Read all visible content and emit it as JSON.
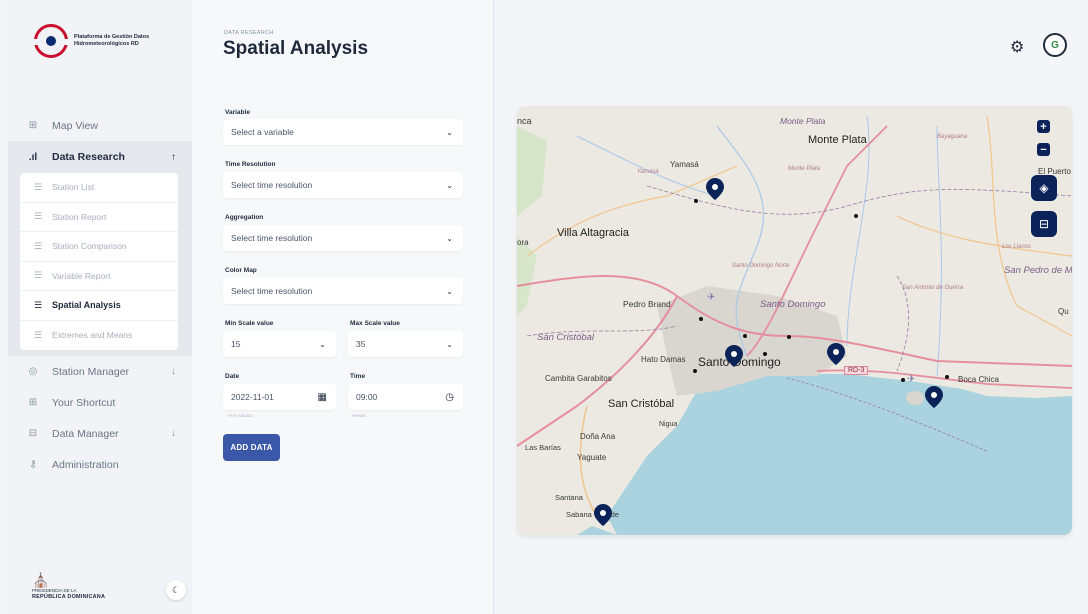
{
  "sidebar": {
    "logo_text": "Plataforma de Gestión Datos Hidrometeorológicos RD",
    "items": [
      {
        "label": "Map View",
        "icon": "map-icon"
      },
      {
        "label": "Data Research",
        "icon": "chart-icon"
      },
      {
        "label": "Station Manager",
        "icon": "location-icon"
      },
      {
        "label": "Your Shortcut",
        "icon": "grid-icon"
      },
      {
        "label": "Data Manager",
        "icon": "database-icon"
      },
      {
        "label": "Administration",
        "icon": "key-icon"
      }
    ],
    "submenu": [
      "Station List",
      "Station Report",
      "Station Comparison",
      "Variable Report",
      "Spatial Analysis",
      "Extremes and Means"
    ],
    "footer_line1": "PRESIDENCIA DE LA",
    "footer_line2": "REPÚBLICA DOMINICANA"
  },
  "header": {
    "eyebrow": "DATA RESEARCH",
    "title": "Spatial Analysis"
  },
  "form": {
    "variable_label": "Variable",
    "variable_value": "Select a variable",
    "time_resolution_label": "Time Resolution",
    "time_resolution_value": "Select time resolution",
    "aggregation_label": "Aggregation",
    "aggregation_value": "Select time resolution",
    "color_map_label": "Color Map",
    "color_map_value": "Select time resolution",
    "min_scale_label": "Min Scale value",
    "min_scale_value": "15",
    "max_scale_label": "Max Scale value",
    "max_scale_value": "35",
    "date_label": "Date",
    "date_value": "2022-11-01",
    "date_hint": "YYYY-MM-DD",
    "time_label": "Time",
    "time_value": "09:00",
    "time_hint": "HH:MM",
    "add_button": "ADD DATA"
  },
  "topbar": {
    "avatar_initials": "G"
  },
  "map": {
    "places": {
      "monte_plata_italic": "Monte Plata",
      "monte_plata": "Monte Plata",
      "bayaguana": "Bayaguana",
      "yamasa": "Yamasá",
      "yamasa_italic": "Yamasá",
      "monte_plata_faint": "Monte Plata",
      "el_puerto": "El Puerto",
      "villa_altagracia": "Villa Altagracia",
      "los_llanos": "Los Llanos",
      "santo_domingo_norte": "Santo Domingo Norte",
      "san_pedro": "San Pedro de Macorís",
      "pedro_brand": "Pedro Brand",
      "santo_domingo_prov": "Santo Domingo",
      "san_antonio": "San Antonio de Guerra",
      "san_cristobal_prov": "San Cristóbal",
      "hato_damas": "Hato Damas",
      "santo_domingo": "Santo Domingo",
      "rd3": "RD-3",
      "cambita": "Cambita Garabitos",
      "boca_chica": "Boca Chica",
      "san_cristobal": "San Cristóbal",
      "nigua": "Nigua",
      "dona_ana": "Doña Ana",
      "las_barias": "Las Barías",
      "yaguate": "Yaguate",
      "santana": "Santana",
      "sabana_grande": "Sabana Grande",
      "nca": "nca",
      "ora": "ora",
      "qu": "Qu"
    }
  }
}
